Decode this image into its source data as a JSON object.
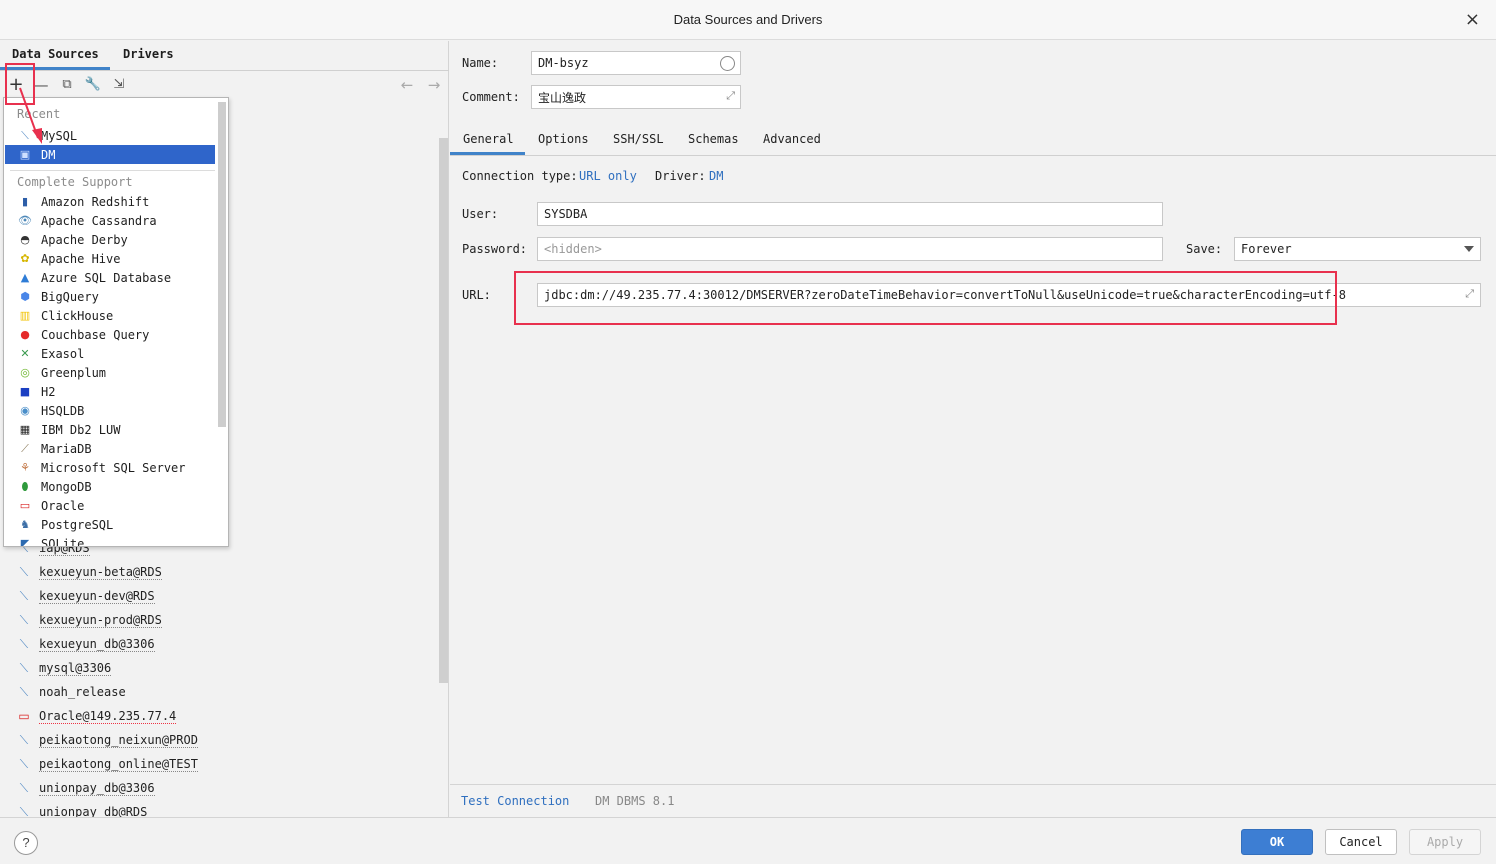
{
  "window": {
    "title": "Data Sources and Drivers",
    "close_glyph": "×"
  },
  "left": {
    "tabs": [
      "Data Sources",
      "Drivers"
    ],
    "toolbar": {
      "add": "+",
      "remove": "—",
      "copy": "⧉",
      "wrench": "🔧",
      "import": "⇲",
      "back": "←",
      "forward": "→"
    },
    "items": [
      {
        "label": "iap@RDS",
        "icon": "mysql-icon"
      },
      {
        "label": "kexueyun-beta@RDS",
        "icon": "mysql-icon"
      },
      {
        "label": "kexueyun-dev@RDS",
        "icon": "mysql-icon"
      },
      {
        "label": "kexueyun-prod@RDS",
        "icon": "mysql-icon"
      },
      {
        "label": "kexueyun_db@3306",
        "icon": "mysql-icon"
      },
      {
        "label": "mysql@3306",
        "icon": "mysql-icon"
      },
      {
        "label": "noah_release",
        "icon": "mysql-icon"
      },
      {
        "label": "Oracle@149.235.77.4",
        "icon": "oracle-icon"
      },
      {
        "label": "peikaotong_neixun@PROD",
        "icon": "mysql-icon"
      },
      {
        "label": "peikaotong_online@TEST",
        "icon": "mysql-icon"
      },
      {
        "label": "unionpay_db@3306",
        "icon": "mysql-icon"
      },
      {
        "label": "unionpay_db@RDS",
        "icon": "mysql-icon"
      }
    ]
  },
  "popup": {
    "recent_label": "Recent",
    "recent": [
      {
        "label": "MySQL",
        "icon": "mysql-icon"
      },
      {
        "label": "DM",
        "icon": "dm-icon",
        "selected": true
      }
    ],
    "complete_label": "Complete Support",
    "complete": [
      {
        "label": "Amazon Redshift",
        "icon": "redshift-icon"
      },
      {
        "label": "Apache Cassandra",
        "icon": "cassandra-icon"
      },
      {
        "label": "Apache Derby",
        "icon": "derby-icon"
      },
      {
        "label": "Apache Hive",
        "icon": "hive-icon"
      },
      {
        "label": "Azure SQL Database",
        "icon": "azure-icon"
      },
      {
        "label": "BigQuery",
        "icon": "bigquery-icon"
      },
      {
        "label": "ClickHouse",
        "icon": "clickhouse-icon"
      },
      {
        "label": "Couchbase Query",
        "icon": "couchbase-icon"
      },
      {
        "label": "Exasol",
        "icon": "exasol-icon"
      },
      {
        "label": "Greenplum",
        "icon": "greenplum-icon"
      },
      {
        "label": "H2",
        "icon": "h2-icon"
      },
      {
        "label": "HSQLDB",
        "icon": "hsqldb-icon"
      },
      {
        "label": "IBM Db2 LUW",
        "icon": "db2-icon"
      },
      {
        "label": "MariaDB",
        "icon": "mariadb-icon"
      },
      {
        "label": "Microsoft SQL Server",
        "icon": "sqlserver-icon"
      },
      {
        "label": "MongoDB",
        "icon": "mongodb-icon"
      },
      {
        "label": "Oracle",
        "icon": "oracle-icon"
      },
      {
        "label": "PostgreSQL",
        "icon": "postgresql-icon"
      },
      {
        "label": "SQLite",
        "icon": "sqlite-icon"
      }
    ]
  },
  "form": {
    "name_label": "Name:",
    "name_value": "DM-bsyz",
    "comment_label": "Comment:",
    "comment_value": "宝山逸政",
    "tabs": [
      "General",
      "Options",
      "SSH/SSL",
      "Schemas",
      "Advanced"
    ],
    "connection_type_label": "Connection type:",
    "connection_type_value": "URL only",
    "driver_label": "Driver:",
    "driver_value": "DM",
    "user_label": "User:",
    "user_value": "SYSDBA",
    "password_label": "Password:",
    "password_placeholder": "<hidden>",
    "save_label": "Save:",
    "save_value": "Forever",
    "url_label": "URL:",
    "url_value": "jdbc:dm://49.235.77.4:30012/DMSERVER?zeroDateTimeBehavior=convertToNull&useUnicode=true&characterEncoding=utf-8",
    "test_connection": "Test Connection",
    "dbms_version": "DM DBMS 8.1"
  },
  "footer": {
    "help": "?",
    "ok": "OK",
    "cancel": "Cancel",
    "apply": "Apply"
  },
  "colors": {
    "accent": "#3d7ed3",
    "highlight": "#e8314e",
    "selection": "#2f65ca"
  }
}
